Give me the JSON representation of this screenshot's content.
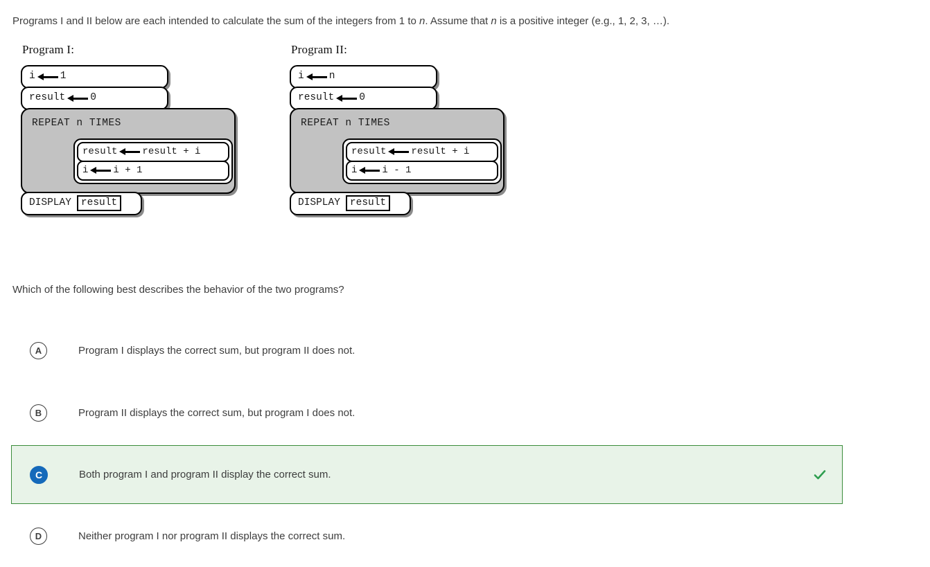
{
  "stem": {
    "part1": "Programs I and II below are each intended to calculate the sum of the integers from 1 to ",
    "var1": "n",
    "part2": ". Assume that ",
    "var2": "n",
    "part3": " is a positive integer (e.g., 1, 2, 3, …)."
  },
  "programs": [
    {
      "title": "Program I:",
      "init": [
        {
          "lhs": "i",
          "rhs": "1"
        },
        {
          "lhs": "result",
          "rhs": "0"
        }
      ],
      "repeat_label": "REPEAT n TIMES",
      "body": [
        {
          "lhs": "result",
          "rhs": "result + i"
        },
        {
          "lhs": "i",
          "rhs": "i + 1"
        }
      ],
      "display_keyword": "DISPLAY",
      "display_value": "result"
    },
    {
      "title": "Program II:",
      "init": [
        {
          "lhs": "i",
          "rhs": "n"
        },
        {
          "lhs": "result",
          "rhs": "0"
        }
      ],
      "repeat_label": "REPEAT n TIMES",
      "body": [
        {
          "lhs": "result",
          "rhs": "result + i"
        },
        {
          "lhs": "i",
          "rhs": "i - 1"
        }
      ],
      "display_keyword": "DISPLAY",
      "display_value": "result"
    }
  ],
  "question": "Which of the following best describes the behavior of the two programs?",
  "choices": [
    {
      "letter": "A",
      "text": "Program I displays the correct sum, but program II does not.",
      "selected": false
    },
    {
      "letter": "B",
      "text": "Program II displays the correct sum, but program I does not.",
      "selected": false
    },
    {
      "letter": "C",
      "text": "Both program I and program II display the correct sum.",
      "selected": true
    },
    {
      "letter": "D",
      "text": "Neither program I nor program II displays the correct sum.",
      "selected": false
    }
  ],
  "colors": {
    "selected_bg": "#e8f3e8",
    "selected_border": "#3a8c3a",
    "selected_badge": "#1569ba",
    "check": "#2e9e4f",
    "repeat_fill": "#c2c2c2",
    "text": "#3d3d3d"
  },
  "icons": {
    "check": "check-icon",
    "assign_arrow": "left-arrow-icon"
  }
}
